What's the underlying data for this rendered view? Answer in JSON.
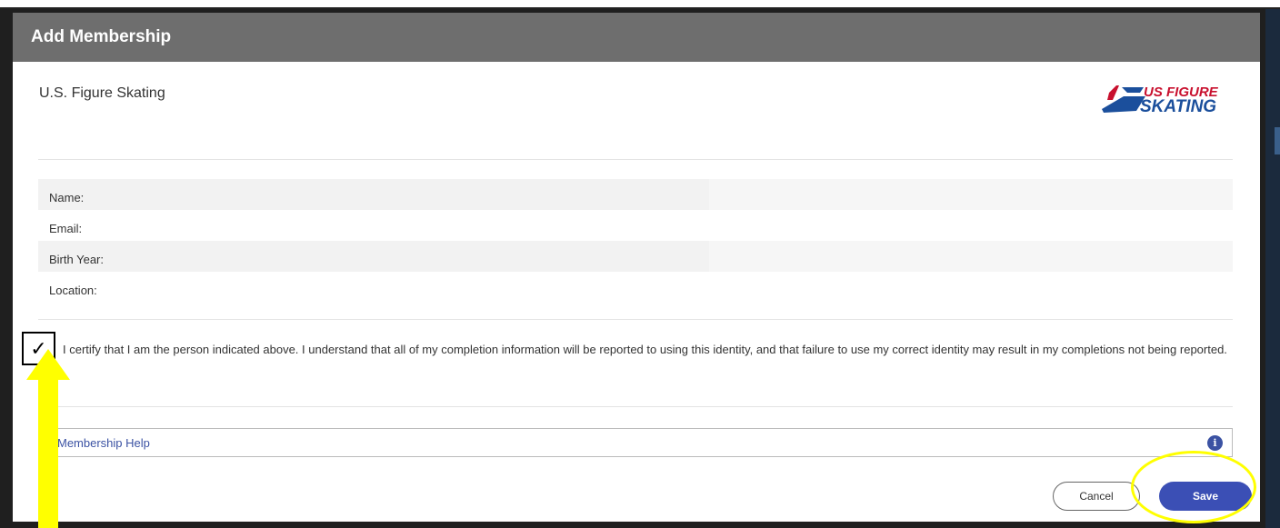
{
  "dialog": {
    "title": "Add Membership",
    "organization": "U.S. Figure Skating",
    "logo": {
      "line1": "US FIGURE",
      "line2": "SKATING",
      "accent_color": "#c8102e",
      "brand_color": "#1b4f9c"
    }
  },
  "fields": [
    {
      "label": "Name:",
      "shaded": true
    },
    {
      "label": "Email:",
      "shaded": false
    },
    {
      "label": "Birth Year:",
      "shaded": true
    },
    {
      "label": "Location:",
      "shaded": false
    }
  ],
  "certify": {
    "checked_glyph": "✓",
    "text": "I certify that I am the person indicated above. I understand that all of my completion information will be reported to using this identity, and that failure to use my correct identity may result in my completions not being reported."
  },
  "help": {
    "link_text": "Membership Help",
    "icon": "info-circle-icon",
    "icon_glyph": "i"
  },
  "buttons": {
    "cancel_label": "Cancel",
    "save_label": "Save",
    "save_color": "#3b4fb5"
  },
  "annotations": {
    "highlight_color": "#ffff00"
  }
}
